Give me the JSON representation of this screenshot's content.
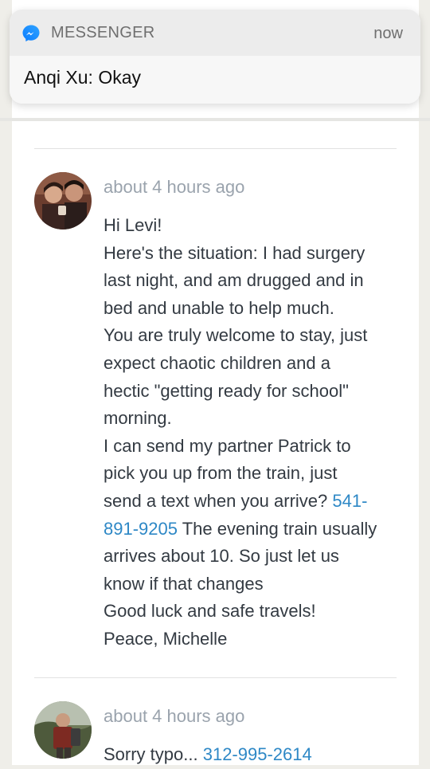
{
  "notification": {
    "app_name": "MESSENGER",
    "time": "now",
    "body": "Anqi Xu: Okay",
    "icon": "messenger-icon"
  },
  "messages": [
    {
      "timestamp": "about 4 hours ago",
      "lines": {
        "l1": "Hi Levi!",
        "l2": "Here's the situation: I had surgery",
        "l3": "last night, and am drugged and in",
        "l4": "bed and unable to help much.",
        "l5": "You are truly welcome to stay, just",
        "l6": "expect chaotic children and a",
        "l7": "hectic \"getting ready for school\"",
        "l8": "morning.",
        "l9": "I can send my partner Patrick to",
        "l10": "pick you up from the train, just",
        "l11_text": "send a text when you arrive?",
        "l11_link": "541-",
        "l12_link": "891-9205",
        "l12_text": "The evening train usually",
        "l13": "arrives about 10. So just let us",
        "l14": "know if that changes",
        "l15": "Good luck and safe travels!",
        "l16": "Peace, Michelle"
      }
    },
    {
      "timestamp": "about 4 hours ago",
      "text": "Sorry typo...",
      "phone": "312-995-2614"
    }
  ]
}
